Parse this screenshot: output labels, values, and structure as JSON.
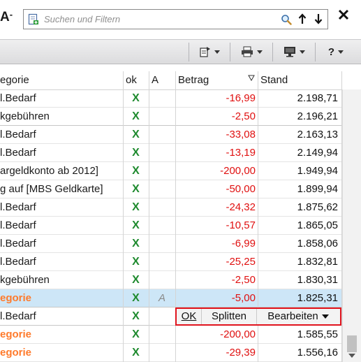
{
  "search": {
    "placeholder": "Suchen und Filtern",
    "value": ""
  },
  "font_button": {
    "letter": "A",
    "suffix": "-"
  },
  "toolbar": {
    "help_label": "?"
  },
  "table": {
    "headers": {
      "category": "egorie",
      "ok": "ok",
      "a": "A",
      "amount": "Betrag",
      "stand": "Stand"
    },
    "rows": [
      {
        "category": "l.Bedarf",
        "ok": "X",
        "a": "",
        "amount": "-16,99",
        "stand": "2.198,71",
        "style": "normal"
      },
      {
        "category": "kgebühren",
        "ok": "X",
        "a": "",
        "amount": "-2,50",
        "stand": "2.196,21",
        "style": "normal"
      },
      {
        "category": "l.Bedarf",
        "ok": "X",
        "a": "",
        "amount": "-33,08",
        "stand": "2.163,13",
        "style": "normal"
      },
      {
        "category": "l.Bedarf",
        "ok": "X",
        "a": "",
        "amount": "-13,19",
        "stand": "2.149,94",
        "style": "normal"
      },
      {
        "category": "argeldkonto ab 2012]",
        "ok": "X",
        "a": "",
        "amount": "-200,00",
        "stand": "1.949,94",
        "style": "normal"
      },
      {
        "category": "g auf [MBS Geldkarte]",
        "ok": "X",
        "a": "",
        "amount": "-50,00",
        "stand": "1.899,94",
        "style": "normal"
      },
      {
        "category": "l.Bedarf",
        "ok": "X",
        "a": "",
        "amount": "-24,32",
        "stand": "1.875,62",
        "style": "normal"
      },
      {
        "category": "l.Bedarf",
        "ok": "X",
        "a": "",
        "amount": "-10,57",
        "stand": "1.865,05",
        "style": "normal"
      },
      {
        "category": "l.Bedarf",
        "ok": "X",
        "a": "",
        "amount": "-6,99",
        "stand": "1.858,06",
        "style": "normal"
      },
      {
        "category": "l.Bedarf",
        "ok": "X",
        "a": "",
        "amount": "-25,25",
        "stand": "1.832,81",
        "style": "normal"
      },
      {
        "category": "kgebühren",
        "ok": "X",
        "a": "",
        "amount": "-2,50",
        "stand": "1.830,31",
        "style": "normal"
      },
      {
        "category": "egorie",
        "ok": "X",
        "a": "A",
        "amount": "-5,00",
        "stand": "1.825,31",
        "style": "selected"
      },
      {
        "category": "l.Bedarf",
        "ok": "X",
        "a": "",
        "amount": "",
        "stand": "",
        "style": "editing"
      },
      {
        "category": "egorie",
        "ok": "X",
        "a": "",
        "amount": "-200,00",
        "stand": "1.585,55",
        "style": "orange"
      },
      {
        "category": "egorie",
        "ok": "X",
        "a": "",
        "amount": "-29,39",
        "stand": "1.556,16",
        "style": "orange"
      }
    ]
  },
  "editor": {
    "ok_label": "OK",
    "split_label": "Splitten",
    "edit_label": "Bearbeiten"
  },
  "colors": {
    "negative": "#e01010",
    "ok_green": "#1e8a2e",
    "orange_category": "#ff7a2b",
    "selection": "#cde6f7",
    "editor_border": "#e0141e"
  }
}
